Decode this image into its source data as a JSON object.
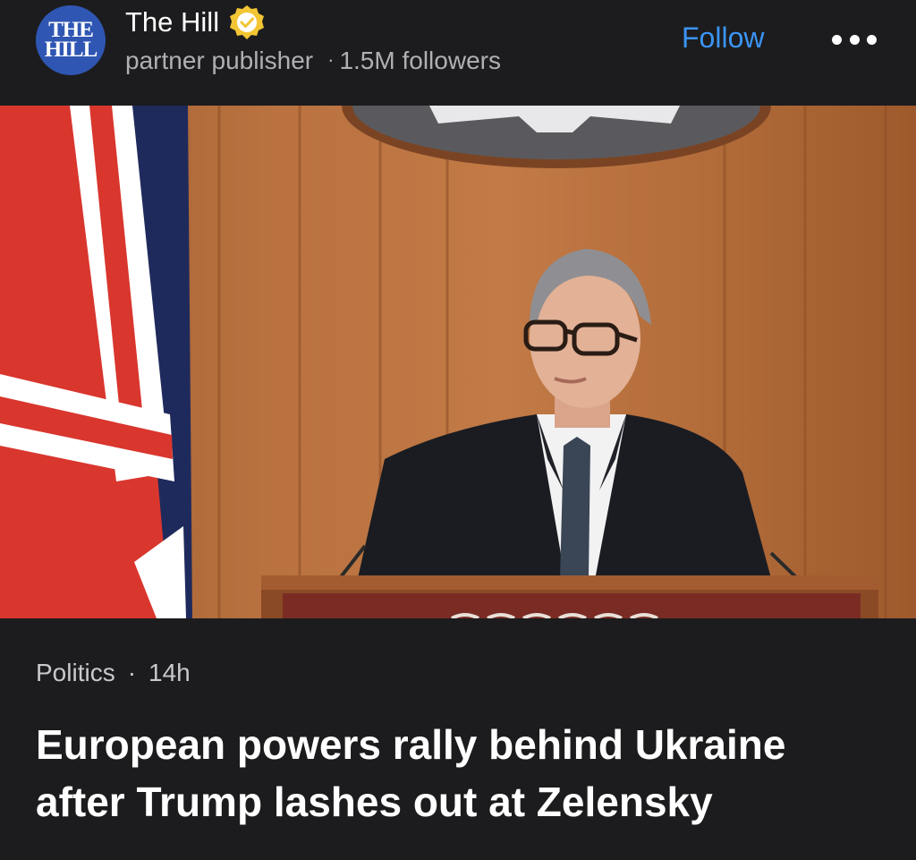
{
  "publisher": {
    "logo_text_line1": "THE",
    "logo_text_line2": "HILL",
    "name": "The Hill",
    "verified": true,
    "type": "partner publisher",
    "separator": "·",
    "followers": "1.5M followers",
    "follow_label": "Follow",
    "more_icon": "more-icon"
  },
  "article": {
    "image_icon": "article-photo",
    "category": "Politics",
    "separator": "·",
    "age": "14h",
    "headline": "European powers rally behind Ukraine after Trump lashes out at Zelensky"
  },
  "colors": {
    "background": "#1c1c1e",
    "accent": "#3b94f5",
    "verified_badge": "#f2c534",
    "logo_bg": "#2f56b3"
  }
}
